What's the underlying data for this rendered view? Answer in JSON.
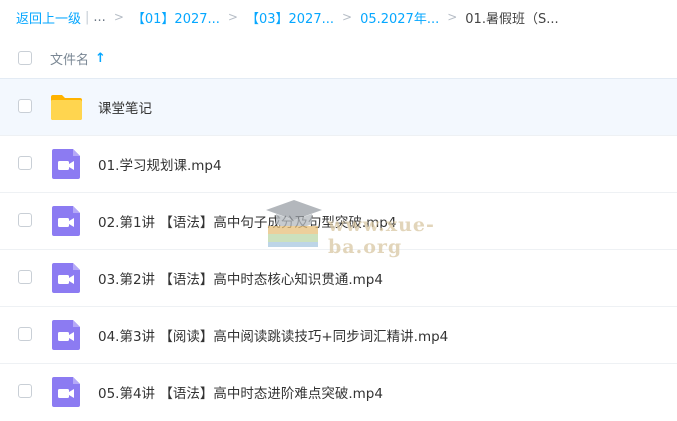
{
  "breadcrumb": {
    "back": "返回上一级",
    "ellipsis": "...",
    "crumbs": [
      "【01】2027...",
      "【03】2027...",
      "05.2027年..."
    ],
    "current": "01.暑假班（S..."
  },
  "header": {
    "name_label": "文件名",
    "sort_icon": "arrow-up-icon"
  },
  "files": [
    {
      "name": "课堂笔记",
      "type": "folder"
    },
    {
      "name": "01.学习规划课.mp4",
      "type": "video"
    },
    {
      "name": "02.第1讲 【语法】高中句子成分及句型突破.mp4",
      "type": "video"
    },
    {
      "name": "03.第2讲 【语法】高中时态核心知识贯通.mp4",
      "type": "video"
    },
    {
      "name": "04.第3讲 【阅读】高中阅读跳读技巧+同步词汇精讲.mp4",
      "type": "video"
    },
    {
      "name": "05.第4讲 【语法】高中时态进阶难点突破.mp4",
      "type": "video"
    }
  ],
  "watermark": {
    "text": "www.xue-ba.org"
  },
  "colors": {
    "accent": "#06a7ff",
    "folder": "#ffc53d",
    "video": "#8c7bf2",
    "highlight": "#f3f8fe"
  }
}
